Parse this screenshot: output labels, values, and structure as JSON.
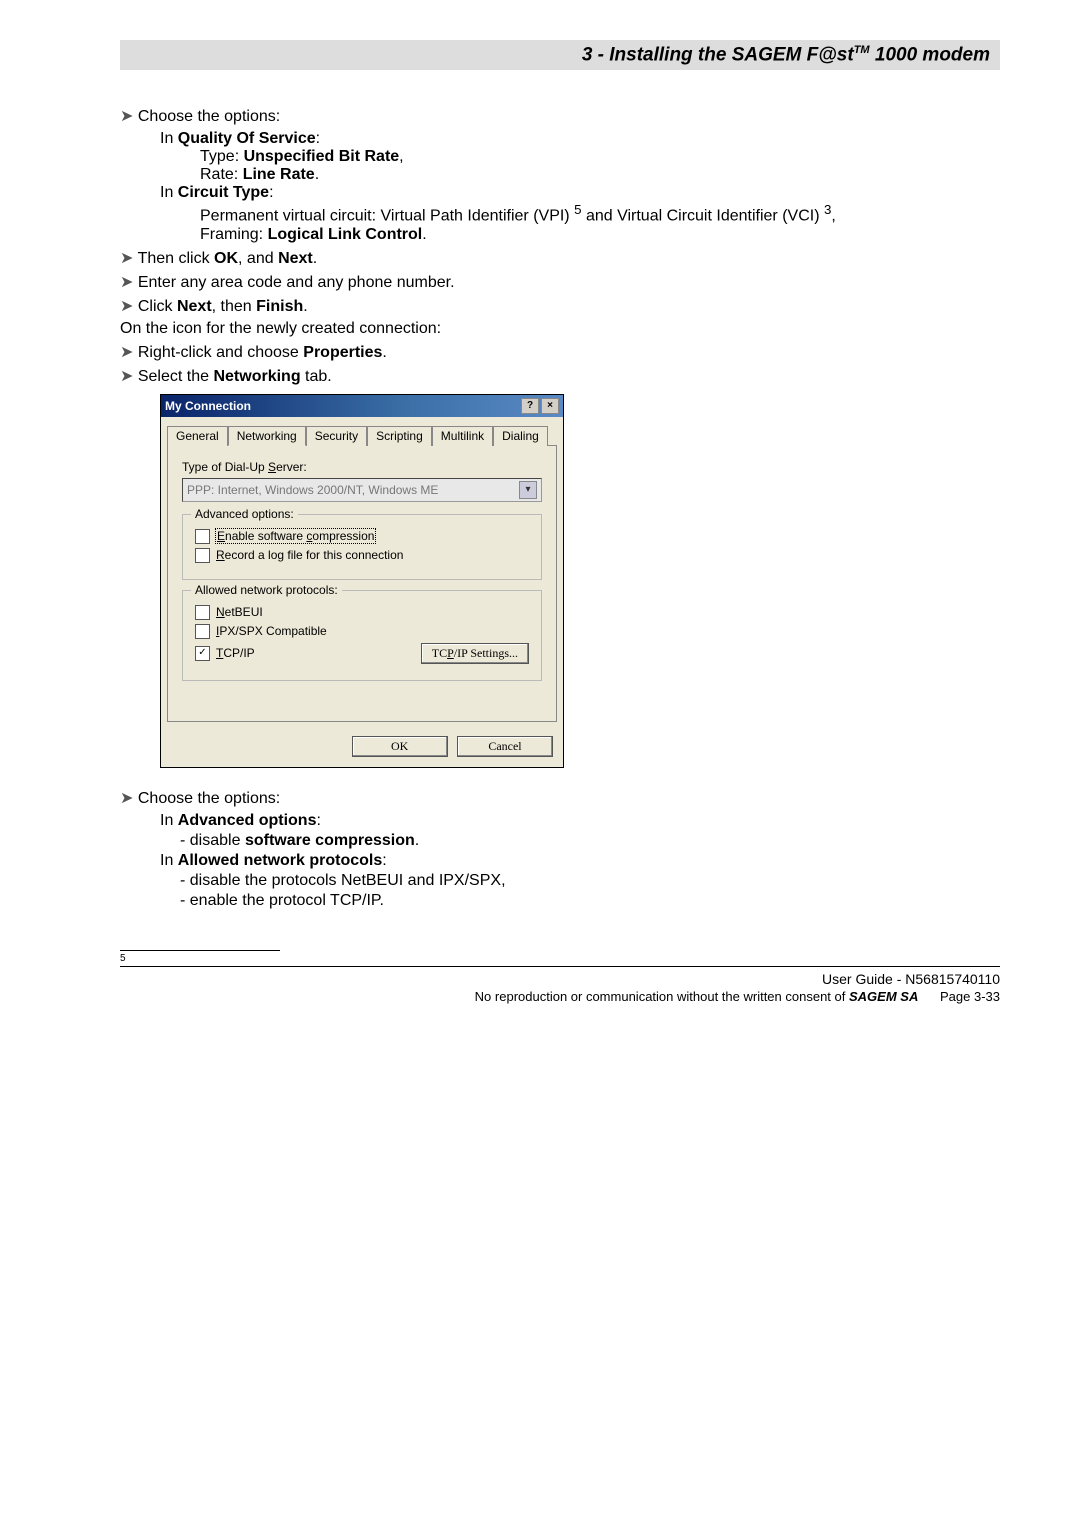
{
  "header": {
    "title_html": "3 - Installing the SAGEM F@st<span class='sup'>TM</span> 1000 modem"
  },
  "content": {
    "choose1": "Choose the options:",
    "in_qos": "In <span class='bold'>Quality Of Service</span>:",
    "type_unspec": "Type: <span class='bold'>Unspecified Bit Rate</span>,",
    "rate_line": "Rate: <span class='bold'>Line Rate</span>.",
    "in_circuit": "In <span class='bold'>Circuit Type</span>:",
    "perm_vc": "Permanent virtual circuit: Virtual Path Identifier (VPI) <sup>5</sup> and Virtual Circuit Identifier (VCI) <sup>3</sup>,",
    "framing": "Framing: <span class='bold'>Logical Link Control</span>.",
    "ok_next": "Then click <span class='bold'>OK</span>, and <span class='bold'>Next</span>.",
    "area_code": "Enter any area code and any phone number.",
    "next_finish": "Click <span class='bold'>Next</span>, then <span class='bold'>Finish</span>.",
    "on_icon": "On the icon for the newly created connection:",
    "right_click": "Right-click and choose <span class='bold'>Properties</span>.",
    "select_net": "Select the <span class='bold'>Networking</span> tab.",
    "choose2": "Choose the options:",
    "in_adv": "In <span class='bold'>Advanced options</span>:",
    "disable_sc": "disable <span class='bold'>software compression</span>.",
    "in_allowed": "In <span class='bold'>Allowed network protocols</span>:",
    "disable_protos": "disable the protocols NetBEUI and IPX/SPX,",
    "enable_tcp": "enable the protocol TCP/IP."
  },
  "dialog": {
    "title": "My Connection",
    "help_icon": "?",
    "close_icon": "×",
    "tabs": [
      "General",
      "Networking",
      "Security",
      "Scripting",
      "Multilink",
      "Dialing"
    ],
    "active_tab": 1,
    "type_label": "Type of Dial-Up Server:",
    "type_value": "PPP: Internet, Windows 2000/NT, Windows ME",
    "adv_title": "Advanced options:",
    "chk_enable_sc": "Enable software compression",
    "chk_record_log": "Record a log file for this connection",
    "allowed_title": "Allowed network protocols:",
    "chk_netbeui": "NetBEUI",
    "chk_ipxspx": "IPX/SPX Compatible",
    "chk_tcpip": "TCP/IP",
    "tcpip_btn": "TCP/IP Settings...",
    "ok": "OK",
    "cancel": "Cancel"
  },
  "footer": {
    "fnum": "5",
    "line1": "User Guide - N56815740110",
    "line2_html": "No reproduction or communication without the written consent of <span class='bold' style='font-style:italic'>SAGEM SA</span>",
    "page": "Page 3-33"
  }
}
